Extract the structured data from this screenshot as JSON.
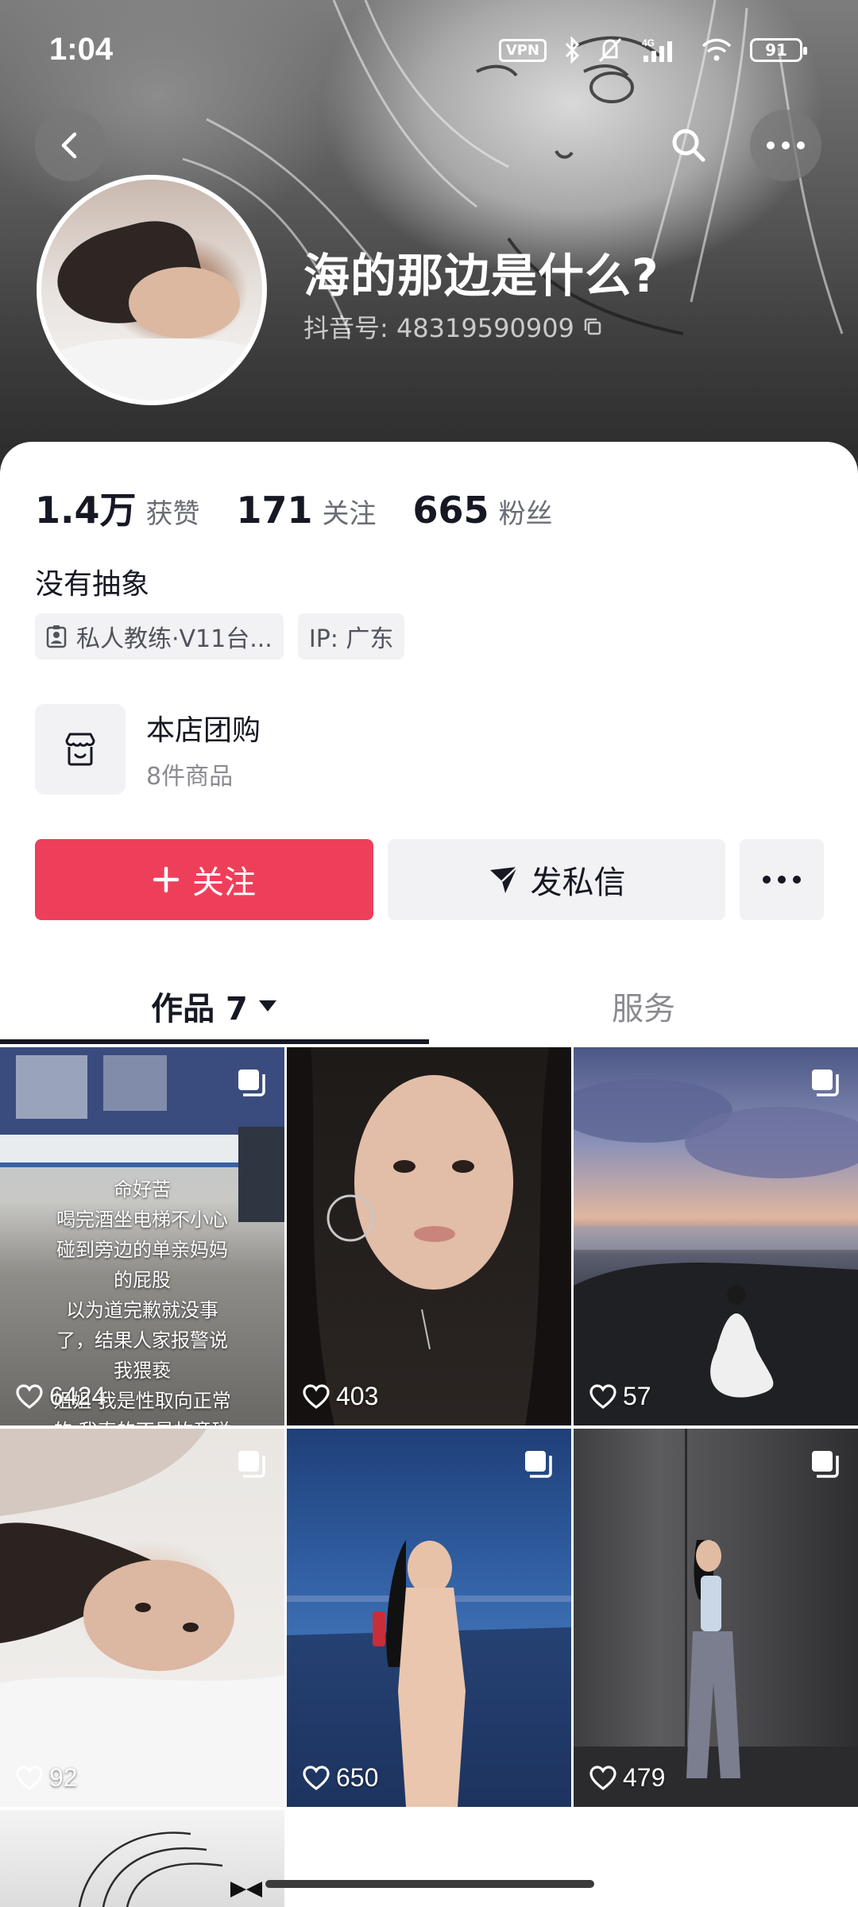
{
  "status_bar": {
    "time": "1:04",
    "vpn": "VPN",
    "network": "4G",
    "battery": "91"
  },
  "header": {
    "nickname": "海的那边是什么?",
    "douyin_id": "抖音号: 48319590909"
  },
  "stats": [
    {
      "value": "1.4万",
      "label": "获赞"
    },
    {
      "value": "171",
      "label": "关注"
    },
    {
      "value": "665",
      "label": "粉丝"
    }
  ],
  "bio": "没有抽象",
  "tags": [
    {
      "icon": "badge-icon",
      "text": "私人教练·V11台..."
    },
    {
      "text": "IP: 广东"
    }
  ],
  "shop": {
    "title": "本店团购",
    "subtitle": "8件商品"
  },
  "actions": {
    "follow_label": "关注",
    "message_label": "发私信"
  },
  "tabs": {
    "works_label": "作品 7",
    "service_label": "服务"
  },
  "posts": [
    {
      "likes": "6424",
      "multi": true,
      "caption": "命好苦\n喝完酒坐电梯不小心\n碰到旁边的单亲妈妈\n的屁股\n以为道完歉就没事\n了，结果人家报警说\n我猥亵\n姐姐 我是性取向正常\n的 我真的不是故意碰\n你的 求你放过我吧\n我真的要减逐了"
    },
    {
      "likes": "403",
      "multi": false
    },
    {
      "likes": "57",
      "multi": true
    },
    {
      "likes": "92",
      "multi": true
    },
    {
      "likes": "650",
      "multi": true
    },
    {
      "likes": "479",
      "multi": true
    }
  ],
  "colors": {
    "accent": "#ee3f5a",
    "text": "#161823",
    "muted": "#8a8b91",
    "chip_bg": "#f2f2f4"
  }
}
